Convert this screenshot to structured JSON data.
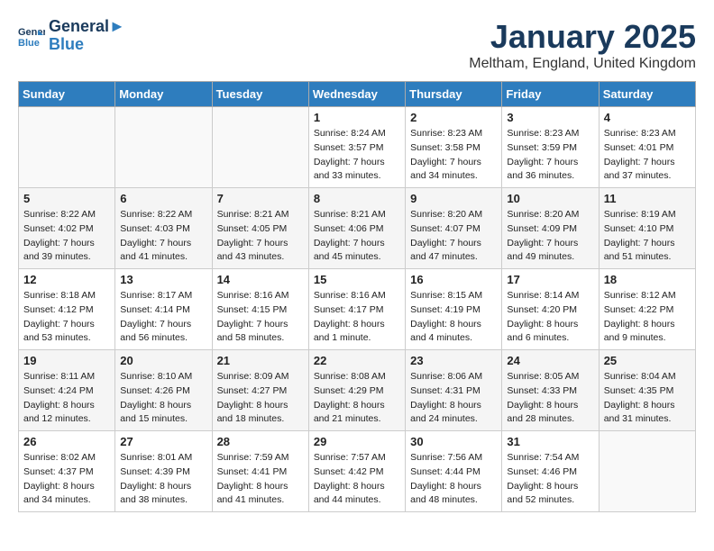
{
  "header": {
    "logo_line1": "General",
    "logo_line2": "Blue",
    "month": "January 2025",
    "location": "Meltham, England, United Kingdom"
  },
  "weekdays": [
    "Sunday",
    "Monday",
    "Tuesday",
    "Wednesday",
    "Thursday",
    "Friday",
    "Saturday"
  ],
  "weeks": [
    [
      {
        "day": "",
        "sunrise": "",
        "sunset": "",
        "daylight": ""
      },
      {
        "day": "",
        "sunrise": "",
        "sunset": "",
        "daylight": ""
      },
      {
        "day": "",
        "sunrise": "",
        "sunset": "",
        "daylight": ""
      },
      {
        "day": "1",
        "sunrise": "Sunrise: 8:24 AM",
        "sunset": "Sunset: 3:57 PM",
        "daylight": "Daylight: 7 hours and 33 minutes."
      },
      {
        "day": "2",
        "sunrise": "Sunrise: 8:23 AM",
        "sunset": "Sunset: 3:58 PM",
        "daylight": "Daylight: 7 hours and 34 minutes."
      },
      {
        "day": "3",
        "sunrise": "Sunrise: 8:23 AM",
        "sunset": "Sunset: 3:59 PM",
        "daylight": "Daylight: 7 hours and 36 minutes."
      },
      {
        "day": "4",
        "sunrise": "Sunrise: 8:23 AM",
        "sunset": "Sunset: 4:01 PM",
        "daylight": "Daylight: 7 hours and 37 minutes."
      }
    ],
    [
      {
        "day": "5",
        "sunrise": "Sunrise: 8:22 AM",
        "sunset": "Sunset: 4:02 PM",
        "daylight": "Daylight: 7 hours and 39 minutes."
      },
      {
        "day": "6",
        "sunrise": "Sunrise: 8:22 AM",
        "sunset": "Sunset: 4:03 PM",
        "daylight": "Daylight: 7 hours and 41 minutes."
      },
      {
        "day": "7",
        "sunrise": "Sunrise: 8:21 AM",
        "sunset": "Sunset: 4:05 PM",
        "daylight": "Daylight: 7 hours and 43 minutes."
      },
      {
        "day": "8",
        "sunrise": "Sunrise: 8:21 AM",
        "sunset": "Sunset: 4:06 PM",
        "daylight": "Daylight: 7 hours and 45 minutes."
      },
      {
        "day": "9",
        "sunrise": "Sunrise: 8:20 AM",
        "sunset": "Sunset: 4:07 PM",
        "daylight": "Daylight: 7 hours and 47 minutes."
      },
      {
        "day": "10",
        "sunrise": "Sunrise: 8:20 AM",
        "sunset": "Sunset: 4:09 PM",
        "daylight": "Daylight: 7 hours and 49 minutes."
      },
      {
        "day": "11",
        "sunrise": "Sunrise: 8:19 AM",
        "sunset": "Sunset: 4:10 PM",
        "daylight": "Daylight: 7 hours and 51 minutes."
      }
    ],
    [
      {
        "day": "12",
        "sunrise": "Sunrise: 8:18 AM",
        "sunset": "Sunset: 4:12 PM",
        "daylight": "Daylight: 7 hours and 53 minutes."
      },
      {
        "day": "13",
        "sunrise": "Sunrise: 8:17 AM",
        "sunset": "Sunset: 4:14 PM",
        "daylight": "Daylight: 7 hours and 56 minutes."
      },
      {
        "day": "14",
        "sunrise": "Sunrise: 8:16 AM",
        "sunset": "Sunset: 4:15 PM",
        "daylight": "Daylight: 7 hours and 58 minutes."
      },
      {
        "day": "15",
        "sunrise": "Sunrise: 8:16 AM",
        "sunset": "Sunset: 4:17 PM",
        "daylight": "Daylight: 8 hours and 1 minute."
      },
      {
        "day": "16",
        "sunrise": "Sunrise: 8:15 AM",
        "sunset": "Sunset: 4:19 PM",
        "daylight": "Daylight: 8 hours and 4 minutes."
      },
      {
        "day": "17",
        "sunrise": "Sunrise: 8:14 AM",
        "sunset": "Sunset: 4:20 PM",
        "daylight": "Daylight: 8 hours and 6 minutes."
      },
      {
        "day": "18",
        "sunrise": "Sunrise: 8:12 AM",
        "sunset": "Sunset: 4:22 PM",
        "daylight": "Daylight: 8 hours and 9 minutes."
      }
    ],
    [
      {
        "day": "19",
        "sunrise": "Sunrise: 8:11 AM",
        "sunset": "Sunset: 4:24 PM",
        "daylight": "Daylight: 8 hours and 12 minutes."
      },
      {
        "day": "20",
        "sunrise": "Sunrise: 8:10 AM",
        "sunset": "Sunset: 4:26 PM",
        "daylight": "Daylight: 8 hours and 15 minutes."
      },
      {
        "day": "21",
        "sunrise": "Sunrise: 8:09 AM",
        "sunset": "Sunset: 4:27 PM",
        "daylight": "Daylight: 8 hours and 18 minutes."
      },
      {
        "day": "22",
        "sunrise": "Sunrise: 8:08 AM",
        "sunset": "Sunset: 4:29 PM",
        "daylight": "Daylight: 8 hours and 21 minutes."
      },
      {
        "day": "23",
        "sunrise": "Sunrise: 8:06 AM",
        "sunset": "Sunset: 4:31 PM",
        "daylight": "Daylight: 8 hours and 24 minutes."
      },
      {
        "day": "24",
        "sunrise": "Sunrise: 8:05 AM",
        "sunset": "Sunset: 4:33 PM",
        "daylight": "Daylight: 8 hours and 28 minutes."
      },
      {
        "day": "25",
        "sunrise": "Sunrise: 8:04 AM",
        "sunset": "Sunset: 4:35 PM",
        "daylight": "Daylight: 8 hours and 31 minutes."
      }
    ],
    [
      {
        "day": "26",
        "sunrise": "Sunrise: 8:02 AM",
        "sunset": "Sunset: 4:37 PM",
        "daylight": "Daylight: 8 hours and 34 minutes."
      },
      {
        "day": "27",
        "sunrise": "Sunrise: 8:01 AM",
        "sunset": "Sunset: 4:39 PM",
        "daylight": "Daylight: 8 hours and 38 minutes."
      },
      {
        "day": "28",
        "sunrise": "Sunrise: 7:59 AM",
        "sunset": "Sunset: 4:41 PM",
        "daylight": "Daylight: 8 hours and 41 minutes."
      },
      {
        "day": "29",
        "sunrise": "Sunrise: 7:57 AM",
        "sunset": "Sunset: 4:42 PM",
        "daylight": "Daylight: 8 hours and 44 minutes."
      },
      {
        "day": "30",
        "sunrise": "Sunrise: 7:56 AM",
        "sunset": "Sunset: 4:44 PM",
        "daylight": "Daylight: 8 hours and 48 minutes."
      },
      {
        "day": "31",
        "sunrise": "Sunrise: 7:54 AM",
        "sunset": "Sunset: 4:46 PM",
        "daylight": "Daylight: 8 hours and 52 minutes."
      },
      {
        "day": "",
        "sunrise": "",
        "sunset": "",
        "daylight": ""
      }
    ]
  ]
}
